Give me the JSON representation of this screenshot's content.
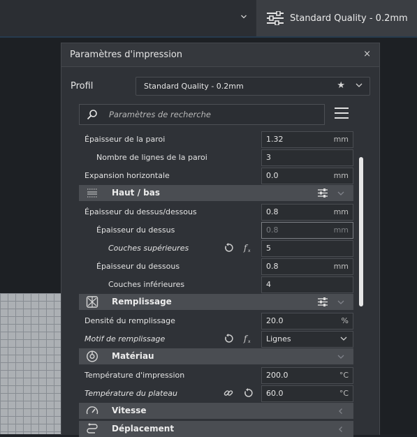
{
  "topbar": {
    "profile_button_label": "Standard Quality - 0.2mm"
  },
  "dialog": {
    "title": "Paramètres d'impression",
    "close": "×"
  },
  "profile": {
    "label": "Profil",
    "value": "Standard Quality - 0.2mm",
    "star": "★"
  },
  "search": {
    "placeholder": "Paramètres de recherche"
  },
  "rows": [
    {
      "label": "Épaisseur de la paroi",
      "value": "1.32",
      "unit": "mm"
    },
    {
      "label": "Nombre de lignes de la paroi",
      "value": "3",
      "unit": ""
    },
    {
      "label": "Expansion horizontale",
      "value": "0.0",
      "unit": "mm"
    },
    {
      "label": "Épaisseur du dessus/dessous",
      "value": "0.8",
      "unit": "mm"
    },
    {
      "label": "Épaisseur du dessus",
      "value": "0.8",
      "unit": "mm"
    },
    {
      "label": "Couches supérieures",
      "value": "5",
      "unit": ""
    },
    {
      "label": "Épaisseur du dessous",
      "value": "0.8",
      "unit": "mm"
    },
    {
      "label": "Couches inférieures",
      "value": "4",
      "unit": ""
    },
    {
      "label": "Densité du remplissage",
      "value": "20.0",
      "unit": "%"
    },
    {
      "label": "Motif de remplissage",
      "value": "Lignes",
      "unit": ""
    },
    {
      "label": "Température d'impression",
      "value": "200.0",
      "unit": "°C"
    },
    {
      "label": "Température du plateau",
      "value": "60.0",
      "unit": "°C"
    }
  ],
  "categories": [
    "Haut / bas",
    "Remplissage",
    "Matériau",
    "Vitesse",
    "Déplacement"
  ]
}
